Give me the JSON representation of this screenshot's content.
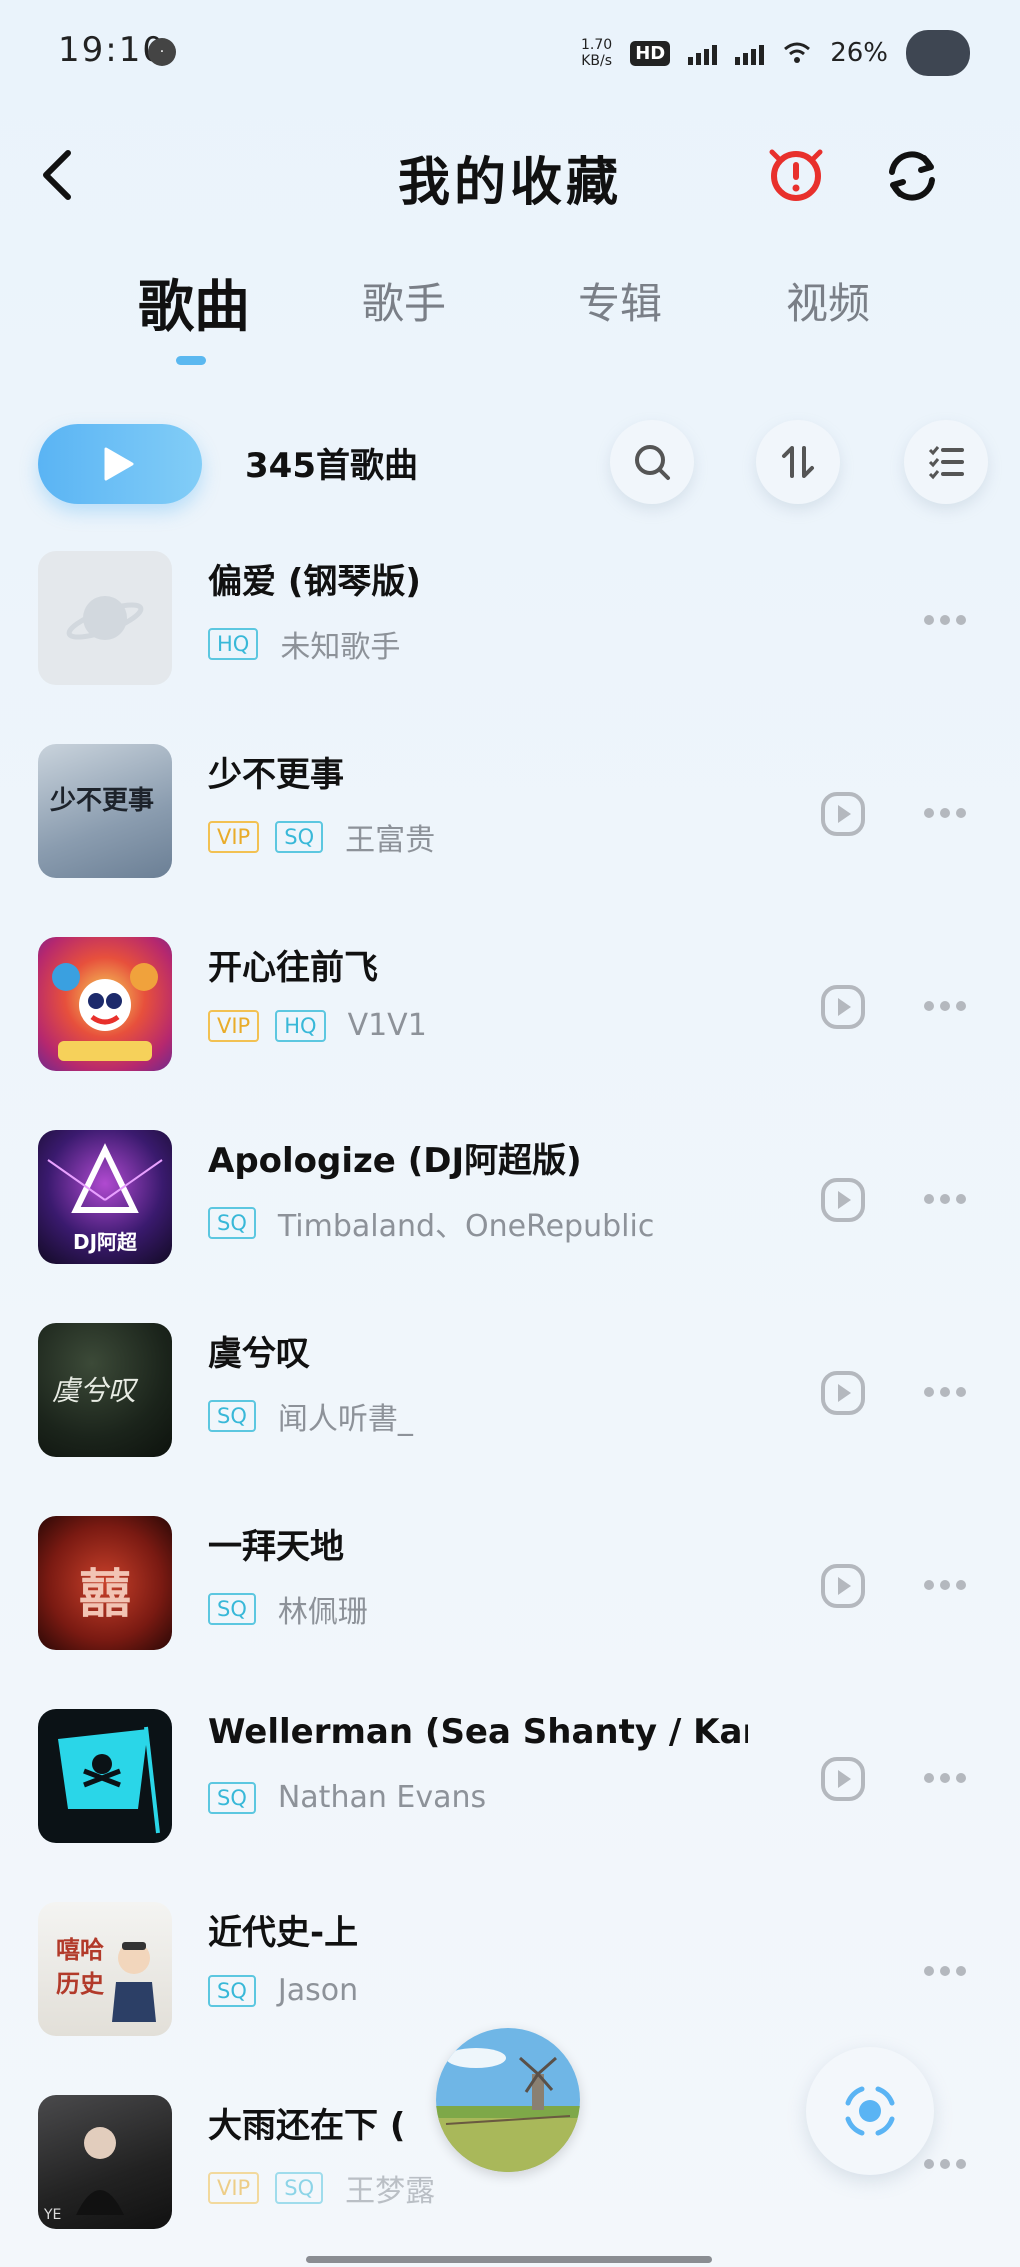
{
  "status_bar": {
    "time": "19:10",
    "speed_value": "1.70",
    "speed_unit": "KB/s",
    "hd_label": "HD",
    "battery": "26%"
  },
  "header": {
    "title": "我的收藏",
    "back_icon": "chevron-left-icon",
    "alert_icon": "alert-icon",
    "sync_icon": "refresh-icon",
    "alert_color": "#e8302c"
  },
  "tabs": [
    {
      "label": "歌曲",
      "active": true
    },
    {
      "label": "歌手",
      "active": false
    },
    {
      "label": "专辑",
      "active": false
    },
    {
      "label": "视频",
      "active": false
    }
  ],
  "controls": {
    "song_count": "345首歌曲",
    "search_icon": "search-icon",
    "sort_icon": "sort-icon",
    "multiselect_icon": "checklist-icon",
    "accent": "#5ab4f4"
  },
  "songs": [
    {
      "title": "偏爱 (钢琴版)",
      "tags": [
        "HQ"
      ],
      "artist": "未知歌手",
      "has_play": false
    },
    {
      "title": "少不更事",
      "tags": [
        "VIP",
        "SQ"
      ],
      "artist": "王富贵",
      "has_play": true
    },
    {
      "title": "开心往前飞",
      "tags": [
        "VIP",
        "HQ"
      ],
      "artist": "V1V1",
      "has_play": true
    },
    {
      "title": "Apologize (DJ阿超版)",
      "tags": [
        "SQ"
      ],
      "artist": "Timbaland、OneRepublic",
      "has_play": true
    },
    {
      "title": "虞兮叹",
      "tags": [
        "SQ"
      ],
      "artist": "闻人听書_",
      "has_play": true
    },
    {
      "title": "一拜天地",
      "tags": [
        "SQ"
      ],
      "artist": "林佩珊",
      "has_play": true
    },
    {
      "title": "Wellerman (Sea Shanty / Karao …",
      "tags": [
        "SQ"
      ],
      "artist": "Nathan Evans",
      "has_play": true
    },
    {
      "title": "近代史-上",
      "tags": [
        "SQ"
      ],
      "artist": "Jason",
      "has_play": false
    },
    {
      "title": "大雨还在下 (",
      "tags": [
        "VIP",
        "SQ"
      ],
      "artist": "王梦露",
      "has_play": false
    }
  ],
  "cover_texts": {
    "c1": "少不更事",
    "c3": "DJ阿超",
    "c4": "虞兮叹",
    "c5": "囍",
    "c7a": "嘻哈",
    "c7b": "历史",
    "c8": "YE"
  },
  "tag_colors": {
    "HQ": "#38b8d8",
    "SQ": "#38b8d8",
    "VIP": "#e9ac2a"
  }
}
